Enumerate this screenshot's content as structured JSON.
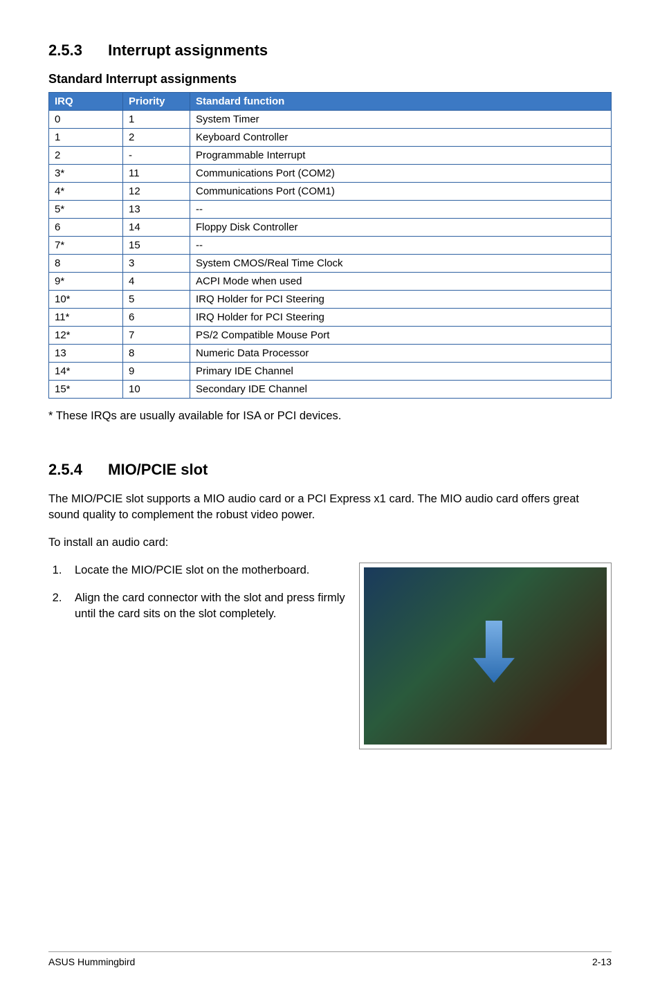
{
  "section_253": {
    "num": "2.5.3",
    "title": "Interrupt assignments"
  },
  "table_heading": "Standard Interrupt assignments",
  "table_headers": {
    "irq": "IRQ",
    "priority": "Priority",
    "func": "Standard function"
  },
  "rows": [
    {
      "irq": "0",
      "priority": "1",
      "func": "System Timer"
    },
    {
      "irq": "1",
      "priority": "2",
      "func": "Keyboard Controller"
    },
    {
      "irq": "2",
      "priority": "-",
      "func": "Programmable Interrupt"
    },
    {
      "irq": "3*",
      "priority": "11",
      "func": "Communications Port (COM2)"
    },
    {
      "irq": "4*",
      "priority": "12",
      "func": "Communications Port (COM1)"
    },
    {
      "irq": "5*",
      "priority": "13",
      "func": "--"
    },
    {
      "irq": "6",
      "priority": "14",
      "func": "Floppy Disk Controller"
    },
    {
      "irq": "7*",
      "priority": "15",
      "func": "--"
    },
    {
      "irq": "8",
      "priority": "3",
      "func": "System CMOS/Real Time Clock"
    },
    {
      "irq": "9*",
      "priority": "4",
      "func": "ACPI Mode when used"
    },
    {
      "irq": "10*",
      "priority": "5",
      "func": "IRQ Holder for PCI Steering"
    },
    {
      "irq": "11*",
      "priority": "6",
      "func": "IRQ Holder for PCI Steering"
    },
    {
      "irq": "12*",
      "priority": "7",
      "func": "PS/2 Compatible Mouse Port"
    },
    {
      "irq": "13",
      "priority": "8",
      "func": "Numeric Data Processor"
    },
    {
      "irq": "14*",
      "priority": "9",
      "func": "Primary IDE Channel"
    },
    {
      "irq": "15*",
      "priority": "10",
      "func": "Secondary IDE Channel"
    }
  ],
  "footnote": "* These IRQs are usually available for ISA or PCI devices.",
  "section_254": {
    "num": "2.5.4",
    "title": "MIO/PCIE slot"
  },
  "mio_intro": "The MIO/PCIE slot supports a MIO audio card or a PCI Express x1 card. The MIO audio card offers great sound quality to complement the robust video power.",
  "install_lead": "To install an audio card:",
  "steps": [
    "Locate the MIO/PCIE slot on the motherboard.",
    "Align the card connector with the slot and press firmly until the card sits on the slot completely."
  ],
  "footer": {
    "left": "ASUS Hummingbird",
    "right": "2-13"
  }
}
